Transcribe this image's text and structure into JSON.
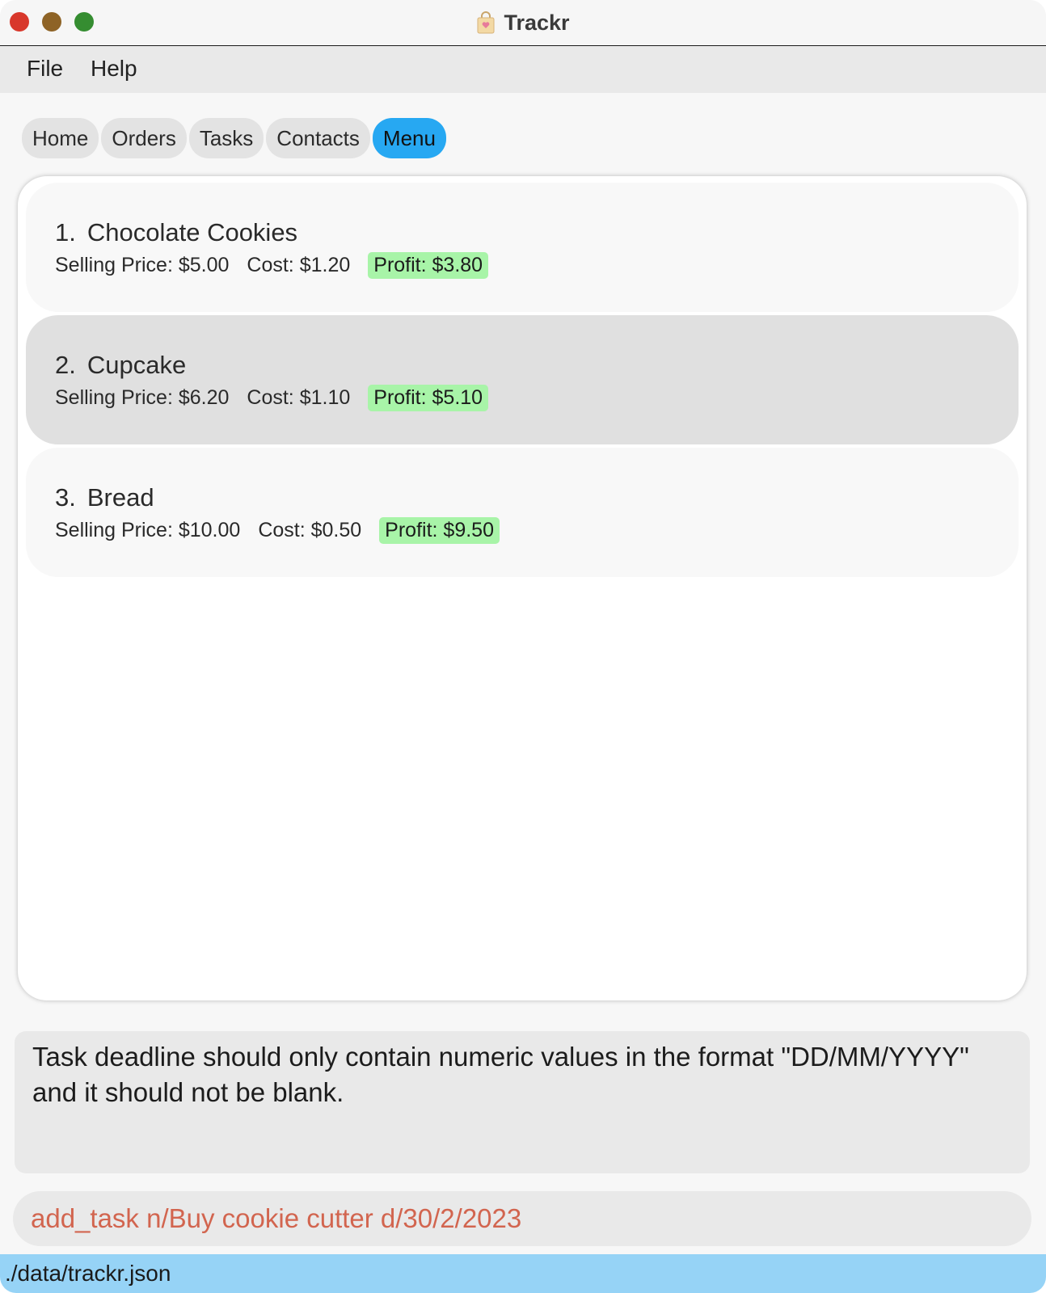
{
  "window": {
    "title": "Trackr"
  },
  "menubar": {
    "items": [
      {
        "label": "File"
      },
      {
        "label": "Help"
      }
    ]
  },
  "tabs": [
    {
      "label": "Home",
      "active": false
    },
    {
      "label": "Orders",
      "active": false
    },
    {
      "label": "Tasks",
      "active": false
    },
    {
      "label": "Contacts",
      "active": false
    },
    {
      "label": "Menu",
      "active": true
    }
  ],
  "menu_items": [
    {
      "index": "1.",
      "name": "Chocolate Cookies",
      "selling_price": "Selling Price: $5.00",
      "cost": "Cost: $1.20",
      "profit": "Profit: $3.80",
      "selected": false
    },
    {
      "index": "2.",
      "name": "Cupcake",
      "selling_price": "Selling Price: $6.20",
      "cost": "Cost: $1.10",
      "profit": "Profit: $5.10",
      "selected": true
    },
    {
      "index": "3.",
      "name": "Bread",
      "selling_price": "Selling Price: $10.00",
      "cost": "Cost: $0.50",
      "profit": "Profit: $9.50",
      "selected": false
    }
  ],
  "result_display": {
    "message": "Task deadline should only contain numeric values in the format \"DD/MM/YYYY\" and it should not be blank."
  },
  "command_box": {
    "value": "add_task n/Buy cookie cutter d/30/2/2023"
  },
  "status_bar": {
    "file_path": "./data/trackr.json"
  },
  "colors": {
    "active_tab": "#27a8f2",
    "profit_badge": "#a8f4a8",
    "command_text_error": "#d2654f",
    "status_bar": "#96d3f6",
    "close_button": "#d8372b",
    "minimize_button": "#8e6326",
    "maximize_button": "#358d31"
  },
  "icons": {
    "app_icon": "shopping-bag-icon"
  }
}
